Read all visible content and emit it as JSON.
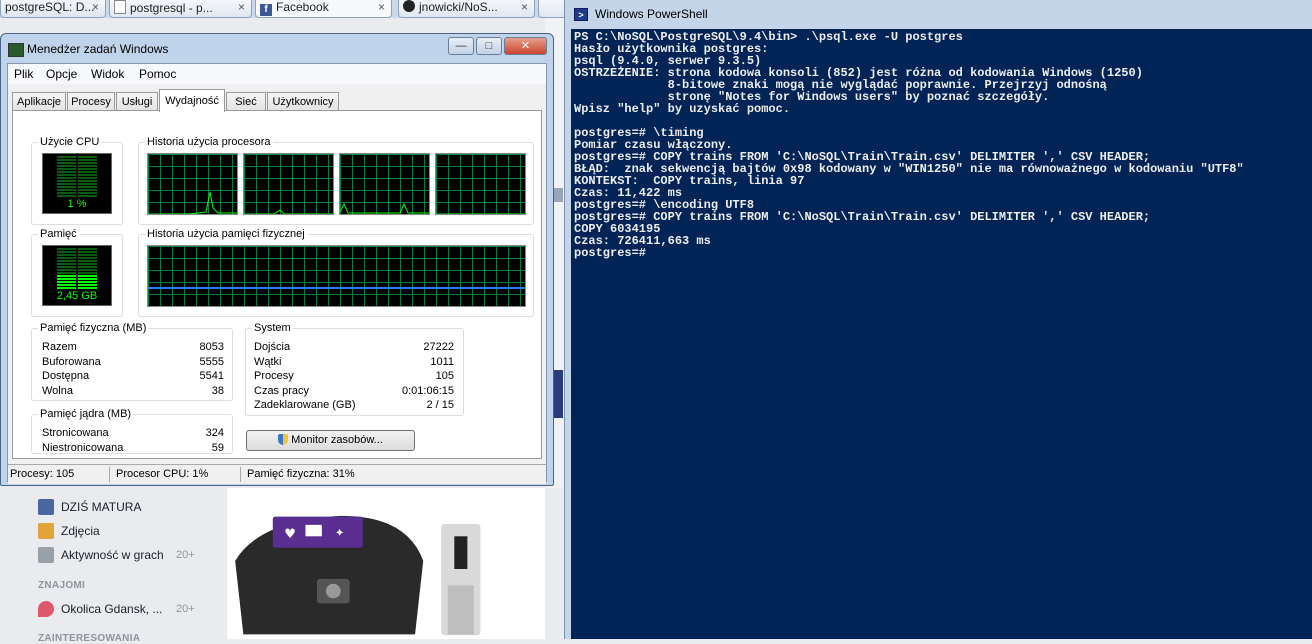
{
  "browser": {
    "tabs": [
      {
        "label": "postgreSQL: D..."
      },
      {
        "label": "postgresql - p..."
      },
      {
        "label": "Facebook"
      },
      {
        "label": "jnowicki/NoS..."
      },
      {
        "label": "×"
      }
    ],
    "facebook": {
      "items": [
        {
          "label": "DZIŚ MATURA",
          "count": ""
        },
        {
          "label": "Zdjęcia",
          "count": ""
        },
        {
          "label": "Aktywność w grach",
          "count": "20+"
        },
        {
          "label": "Okolica Gdansk, ...",
          "count": "20+"
        }
      ],
      "section_friends": "ZNAJOMI",
      "section_interests": "ZAINTERESOWANIA"
    }
  },
  "taskmanager": {
    "title": "Menedżer zadań Windows",
    "window_buttons": {
      "min": "—",
      "max": "□",
      "close": "✕"
    },
    "menu": [
      "Plik",
      "Opcje",
      "Widok",
      "Pomoc"
    ],
    "tabs": [
      "Aplikacje",
      "Procesy",
      "Usługi",
      "Wydajność",
      "Sieć",
      "Użytkownicy"
    ],
    "active_tab": "Wydajność",
    "cpu_usage_label": "Użycie CPU",
    "cpu_usage_value": "1 %",
    "cpu_history_label": "Historia użycia procesora",
    "memory_label": "Pamięć",
    "memory_value": "2,45 GB",
    "memory_history_label": "Historia użycia pamięci fizycznej",
    "physical_memory": {
      "title": "Pamięć fizyczna (MB)",
      "rows": [
        {
          "k": "Razem",
          "v": "8053"
        },
        {
          "k": "Buforowana",
          "v": "5555"
        },
        {
          "k": "Dostępna",
          "v": "5541"
        },
        {
          "k": "Wolna",
          "v": "38"
        }
      ]
    },
    "kernel_memory": {
      "title": "Pamięć jądra (MB)",
      "rows": [
        {
          "k": "Stronicowana",
          "v": "324"
        },
        {
          "k": "Niestronicowana",
          "v": "59"
        }
      ]
    },
    "system": {
      "title": "System",
      "rows": [
        {
          "k": "Dojścia",
          "v": "27222"
        },
        {
          "k": "Wątki",
          "v": "1011"
        },
        {
          "k": "Procesy",
          "v": "105"
        },
        {
          "k": "Czas pracy",
          "v": "0:01:06:15"
        },
        {
          "k": "Zadeklarowane (GB)",
          "v": "2 / 15"
        }
      ]
    },
    "monitor_button": "Monitor zasobów...",
    "status": {
      "processes": "Procesy: 105",
      "cpu": "Procesor CPU: 1%",
      "memory": "Pamięć fizyczna: 31%"
    }
  },
  "powershell": {
    "title": "Windows PowerShell",
    "lines": [
      "PS C:\\NoSQL\\PostgreSQL\\9.4\\bin> .\\psql.exe -U postgres",
      "Hasło użytkownika postgres:",
      "psql (9.4.0, serwer 9.3.5)",
      "OSTRZEŻENIE: strona kodowa konsoli (852) jest różna od kodowania Windows (1250)",
      "             8-bitowe znaki mogą nie wyglądać poprawnie. Przejrzyj odnośną",
      "             stronę \"Notes for Windows users\" by poznać szczegóły.",
      "Wpisz \"help\" by uzyskać pomoc.",
      "",
      "postgres=# \\timing",
      "Pomiar czasu włączony.",
      "postgres=# COPY trains FROM 'C:\\NoSQL\\Train\\Train.csv' DELIMITER ',' CSV HEADER;",
      "BŁĄD:  znak sekwencją bajtów 0x98 kodowany w \"WIN1250\" nie ma równoważnego w kodowaniu \"UTF8\"",
      "KONTEKST:  COPY trains, linia 97",
      "Czas: 11,422 ms",
      "postgres=# \\encoding UTF8",
      "postgres=# COPY trains FROM 'C:\\NoSQL\\Train\\Train.csv' DELIMITER ',' CSV HEADER;",
      "COPY 6034195",
      "Czas: 726411,663 ms",
      "postgres=#"
    ]
  }
}
